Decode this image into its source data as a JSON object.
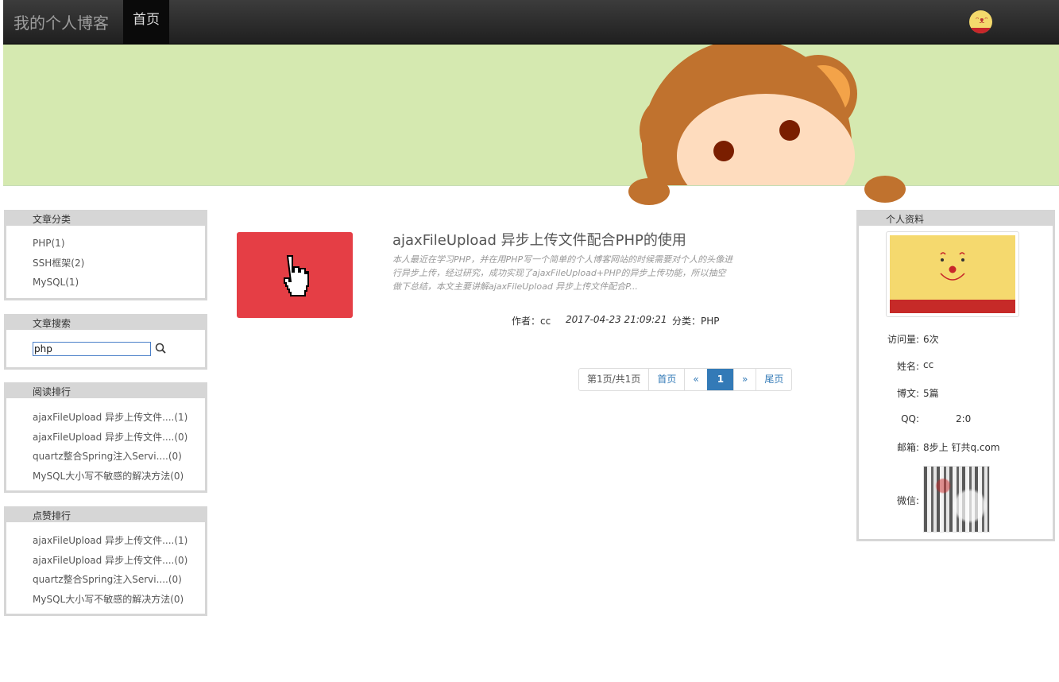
{
  "navbar": {
    "brand": "我的个人博客",
    "home": "首页"
  },
  "categories": {
    "title": "文章分类",
    "items": [
      "PHP(1)",
      "SSH框架(2)",
      "MySQL(1)"
    ]
  },
  "search": {
    "title": "文章搜索",
    "value": "php"
  },
  "read_rank": {
    "title": "阅读排行",
    "items": [
      "ajaxFileUpload 异步上传文件....(1)",
      "ajaxFileUpload 异步上传文件....(0)",
      "quartz整合Spring注入Servi....(0)",
      "MySQL大小写不敏感的解决方法(0)"
    ]
  },
  "like_rank": {
    "title": "点赞排行",
    "items": [
      "ajaxFileUpload 异步上传文件....(1)",
      "ajaxFileUpload 异步上传文件....(0)",
      "quartz整合Spring注入Servi....(0)",
      "MySQL大小写不敏感的解决方法(0)"
    ]
  },
  "article": {
    "title": "ajaxFileUpload 异步上传文件配合PHP的使用",
    "summary": "本人最近在学习PHP，并在用PHP写一个简单的个人博客网站的时候需要对个人的头像进行异步上传，经过研究，成功实现了ajaxFileUpload+PHP的异步上传功能，所以抽空做下总结，本文主要讲解ajaxFileUpload 异步上传文件配合P...",
    "author": "作者：cc",
    "date": "2017-04-23 21:09:21",
    "category": "分类：PHP"
  },
  "pager": {
    "info": "第1页/共1页",
    "first": "首页",
    "prev": "«",
    "current": "1",
    "next": "»",
    "last": "尾页"
  },
  "profile": {
    "title": "个人资料",
    "visits_label": "访问量:",
    "visits": "6次",
    "name_label": "姓名:",
    "name": "cc",
    "posts_label": "博文:",
    "posts": "5篇",
    "qq_label": "QQ:",
    "qq": "2:0",
    "email_label": "邮箱:",
    "email": "8步上 钉共q.com",
    "wechat_label": "微信:"
  },
  "colors": {
    "accent": "#337ab7",
    "banner": "#d5e9b0",
    "thumb": "#e53e45"
  }
}
